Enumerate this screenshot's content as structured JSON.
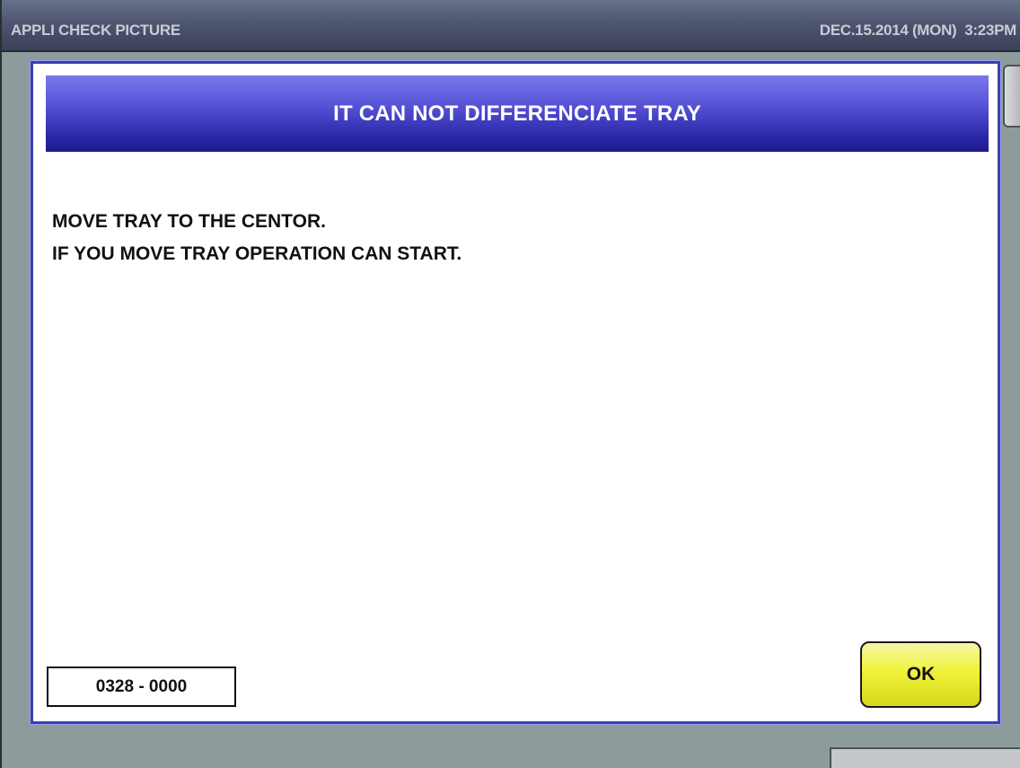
{
  "title_bar": {
    "app_title": "APPLI CHECK PICTURE",
    "datetime": "DEC.15.2014 (MON)  3:23PM"
  },
  "dialog": {
    "title": "IT CAN NOT DIFFERENCIATE TRAY",
    "message_lines": [
      "MOVE TRAY TO THE CENTOR.",
      "IF YOU MOVE TRAY OPERATION CAN START."
    ],
    "error_code": "0328 - 0000",
    "ok_label": "OK"
  },
  "colors": {
    "background": "#8e9b9c",
    "header_blue": "#2a27a8",
    "ok_button_yellow": "#f0f238",
    "dialog_border": "#3a3fb0"
  }
}
